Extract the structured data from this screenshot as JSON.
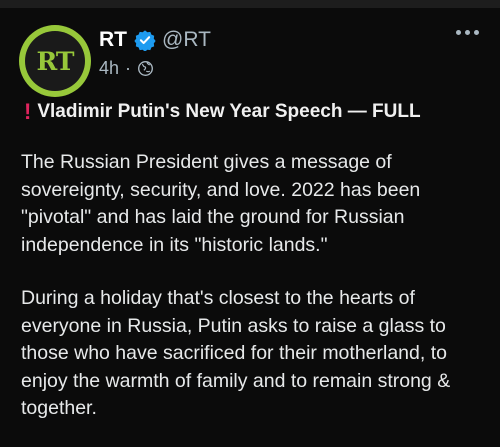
{
  "account": {
    "name": "RT",
    "handle": "@RT",
    "age": "4h",
    "separator": "·",
    "logo_text": "RT"
  },
  "icons": {
    "verified": "verified-badge-icon",
    "visibility": "globe-icon",
    "more": "more-options-icon",
    "alert": "exclamation-icon"
  },
  "colors": {
    "background": "#0b0b0b",
    "brand": "#97c83a",
    "verified": "#1d9bf0",
    "alert": "#e0245e"
  },
  "post": {
    "headline_mark": "!",
    "headline": "Vladimir Putin's New Year Speech — FULL",
    "paragraph1": "The Russian President gives a message of sovereignty, security, and love. 2022 has been \"pivotal\" and has laid the ground for Russian independence in its \"historic lands.\"",
    "paragraph2": "During a holiday that's closest to the hearts of everyone in Russia, Putin asks to raise a glass to those who have sacrificed for their motherland, to enjoy the warmth of family and to remain strong & together."
  }
}
